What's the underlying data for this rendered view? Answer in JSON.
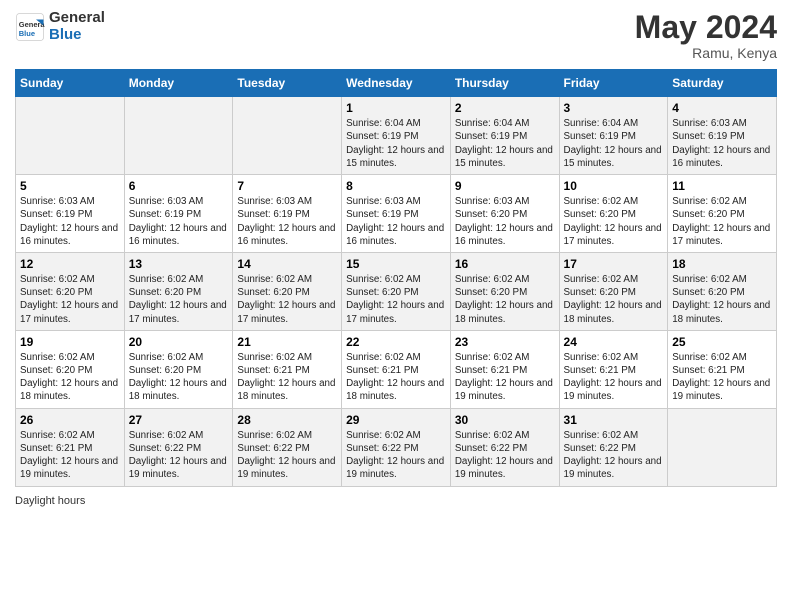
{
  "header": {
    "logo_line1": "General",
    "logo_line2": "Blue",
    "title": "May 2024",
    "subtitle": "Ramu, Kenya"
  },
  "columns": [
    "Sunday",
    "Monday",
    "Tuesday",
    "Wednesday",
    "Thursday",
    "Friday",
    "Saturday"
  ],
  "footer": "Daylight hours",
  "weeks": [
    {
      "days": [
        {
          "num": "",
          "sunrise": "",
          "sunset": "",
          "daylight": ""
        },
        {
          "num": "",
          "sunrise": "",
          "sunset": "",
          "daylight": ""
        },
        {
          "num": "",
          "sunrise": "",
          "sunset": "",
          "daylight": ""
        },
        {
          "num": "1",
          "sunrise": "Sunrise: 6:04 AM",
          "sunset": "Sunset: 6:19 PM",
          "daylight": "Daylight: 12 hours and 15 minutes."
        },
        {
          "num": "2",
          "sunrise": "Sunrise: 6:04 AM",
          "sunset": "Sunset: 6:19 PM",
          "daylight": "Daylight: 12 hours and 15 minutes."
        },
        {
          "num": "3",
          "sunrise": "Sunrise: 6:04 AM",
          "sunset": "Sunset: 6:19 PM",
          "daylight": "Daylight: 12 hours and 15 minutes."
        },
        {
          "num": "4",
          "sunrise": "Sunrise: 6:03 AM",
          "sunset": "Sunset: 6:19 PM",
          "daylight": "Daylight: 12 hours and 16 minutes."
        }
      ]
    },
    {
      "days": [
        {
          "num": "5",
          "sunrise": "Sunrise: 6:03 AM",
          "sunset": "Sunset: 6:19 PM",
          "daylight": "Daylight: 12 hours and 16 minutes."
        },
        {
          "num": "6",
          "sunrise": "Sunrise: 6:03 AM",
          "sunset": "Sunset: 6:19 PM",
          "daylight": "Daylight: 12 hours and 16 minutes."
        },
        {
          "num": "7",
          "sunrise": "Sunrise: 6:03 AM",
          "sunset": "Sunset: 6:19 PM",
          "daylight": "Daylight: 12 hours and 16 minutes."
        },
        {
          "num": "8",
          "sunrise": "Sunrise: 6:03 AM",
          "sunset": "Sunset: 6:19 PM",
          "daylight": "Daylight: 12 hours and 16 minutes."
        },
        {
          "num": "9",
          "sunrise": "Sunrise: 6:03 AM",
          "sunset": "Sunset: 6:20 PM",
          "daylight": "Daylight: 12 hours and 16 minutes."
        },
        {
          "num": "10",
          "sunrise": "Sunrise: 6:02 AM",
          "sunset": "Sunset: 6:20 PM",
          "daylight": "Daylight: 12 hours and 17 minutes."
        },
        {
          "num": "11",
          "sunrise": "Sunrise: 6:02 AM",
          "sunset": "Sunset: 6:20 PM",
          "daylight": "Daylight: 12 hours and 17 minutes."
        }
      ]
    },
    {
      "days": [
        {
          "num": "12",
          "sunrise": "Sunrise: 6:02 AM",
          "sunset": "Sunset: 6:20 PM",
          "daylight": "Daylight: 12 hours and 17 minutes."
        },
        {
          "num": "13",
          "sunrise": "Sunrise: 6:02 AM",
          "sunset": "Sunset: 6:20 PM",
          "daylight": "Daylight: 12 hours and 17 minutes."
        },
        {
          "num": "14",
          "sunrise": "Sunrise: 6:02 AM",
          "sunset": "Sunset: 6:20 PM",
          "daylight": "Daylight: 12 hours and 17 minutes."
        },
        {
          "num": "15",
          "sunrise": "Sunrise: 6:02 AM",
          "sunset": "Sunset: 6:20 PM",
          "daylight": "Daylight: 12 hours and 17 minutes."
        },
        {
          "num": "16",
          "sunrise": "Sunrise: 6:02 AM",
          "sunset": "Sunset: 6:20 PM",
          "daylight": "Daylight: 12 hours and 18 minutes."
        },
        {
          "num": "17",
          "sunrise": "Sunrise: 6:02 AM",
          "sunset": "Sunset: 6:20 PM",
          "daylight": "Daylight: 12 hours and 18 minutes."
        },
        {
          "num": "18",
          "sunrise": "Sunrise: 6:02 AM",
          "sunset": "Sunset: 6:20 PM",
          "daylight": "Daylight: 12 hours and 18 minutes."
        }
      ]
    },
    {
      "days": [
        {
          "num": "19",
          "sunrise": "Sunrise: 6:02 AM",
          "sunset": "Sunset: 6:20 PM",
          "daylight": "Daylight: 12 hours and 18 minutes."
        },
        {
          "num": "20",
          "sunrise": "Sunrise: 6:02 AM",
          "sunset": "Sunset: 6:20 PM",
          "daylight": "Daylight: 12 hours and 18 minutes."
        },
        {
          "num": "21",
          "sunrise": "Sunrise: 6:02 AM",
          "sunset": "Sunset: 6:21 PM",
          "daylight": "Daylight: 12 hours and 18 minutes."
        },
        {
          "num": "22",
          "sunrise": "Sunrise: 6:02 AM",
          "sunset": "Sunset: 6:21 PM",
          "daylight": "Daylight: 12 hours and 18 minutes."
        },
        {
          "num": "23",
          "sunrise": "Sunrise: 6:02 AM",
          "sunset": "Sunset: 6:21 PM",
          "daylight": "Daylight: 12 hours and 19 minutes."
        },
        {
          "num": "24",
          "sunrise": "Sunrise: 6:02 AM",
          "sunset": "Sunset: 6:21 PM",
          "daylight": "Daylight: 12 hours and 19 minutes."
        },
        {
          "num": "25",
          "sunrise": "Sunrise: 6:02 AM",
          "sunset": "Sunset: 6:21 PM",
          "daylight": "Daylight: 12 hours and 19 minutes."
        }
      ]
    },
    {
      "days": [
        {
          "num": "26",
          "sunrise": "Sunrise: 6:02 AM",
          "sunset": "Sunset: 6:21 PM",
          "daylight": "Daylight: 12 hours and 19 minutes."
        },
        {
          "num": "27",
          "sunrise": "Sunrise: 6:02 AM",
          "sunset": "Sunset: 6:22 PM",
          "daylight": "Daylight: 12 hours and 19 minutes."
        },
        {
          "num": "28",
          "sunrise": "Sunrise: 6:02 AM",
          "sunset": "Sunset: 6:22 PM",
          "daylight": "Daylight: 12 hours and 19 minutes."
        },
        {
          "num": "29",
          "sunrise": "Sunrise: 6:02 AM",
          "sunset": "Sunset: 6:22 PM",
          "daylight": "Daylight: 12 hours and 19 minutes."
        },
        {
          "num": "30",
          "sunrise": "Sunrise: 6:02 AM",
          "sunset": "Sunset: 6:22 PM",
          "daylight": "Daylight: 12 hours and 19 minutes."
        },
        {
          "num": "31",
          "sunrise": "Sunrise: 6:02 AM",
          "sunset": "Sunset: 6:22 PM",
          "daylight": "Daylight: 12 hours and 19 minutes."
        },
        {
          "num": "",
          "sunrise": "",
          "sunset": "",
          "daylight": ""
        }
      ]
    }
  ]
}
